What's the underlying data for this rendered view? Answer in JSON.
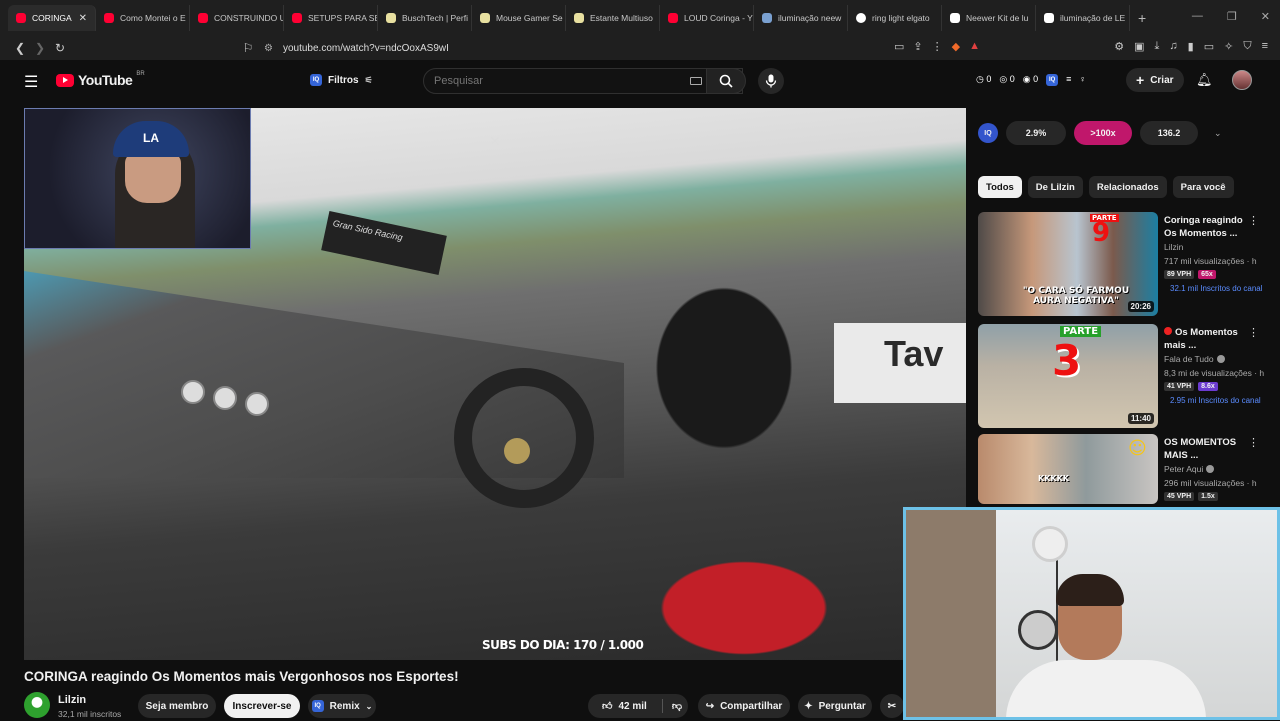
{
  "browser": {
    "tabs": [
      {
        "label": "CORINGA",
        "active": true,
        "favicon_color": "#ff0033"
      },
      {
        "label": "Como Montei o E",
        "favicon_color": "#ff0033"
      },
      {
        "label": "CONSTRUINDO U",
        "favicon_color": "#ff0033"
      },
      {
        "label": "SETUPS PARA SE",
        "favicon_color": "#ff0033"
      },
      {
        "label": "BuschTech | Perfi",
        "favicon_color": "#e8e0a0"
      },
      {
        "label": "Mouse Gamer Se",
        "favicon_color": "#e8e0a0"
      },
      {
        "label": "Estante Multiuso",
        "favicon_color": "#e8e0a0"
      },
      {
        "label": "LOUD Coringa - Y",
        "favicon_color": "#ff0033"
      },
      {
        "label": "iluminação neew",
        "favicon_color": "#7aa0d0"
      },
      {
        "label": "ring light elgato",
        "favicon_color": "#ffffff"
      },
      {
        "label": "Neewer Kit de lu",
        "favicon_color": "#ffffff"
      },
      {
        "label": "iluminação de LE",
        "favicon_color": "#ffffff"
      }
    ],
    "url": "youtube.com/watch?v=ndcOoxAS9wI"
  },
  "header": {
    "logo_text": "YouTube",
    "logo_region": "BR",
    "filters_label": "Filtros",
    "search_placeholder": "Pesquisar",
    "stats": [
      "0",
      "0",
      "0"
    ],
    "create_label": "Criar"
  },
  "player": {
    "subs_overlay": "SUBS DO DIA: 170 / 1.000",
    "banner_left": "Gran Sido Racing",
    "banner_right": "Tav"
  },
  "video": {
    "title": "CORINGA reagindo Os Momentos mais Vergonhosos nos Esportes!",
    "channel": "Lilzin",
    "subscribers": "32,1 mil inscritos",
    "member_label": "Seja membro",
    "subscribe_label": "Inscrever-se",
    "remix_label": "Remix",
    "likes": "42 mil",
    "share_label": "Compartilhar",
    "ask_label": "Perguntar"
  },
  "extension": {
    "stat1": "2.9%",
    "stat2": ">100x",
    "stat3": "136.2"
  },
  "chips": [
    "Todos",
    "De Lilzin",
    "Relacionados",
    "Para você"
  ],
  "recommendations": [
    {
      "title": "Coringa reagindo Os Momentos ...",
      "channel": "Lilzin",
      "views": "717 mil visualizações · h",
      "vph": "89 VPH",
      "mult": "65x",
      "inscritos": "32.1 mil Inscritos do canal",
      "duration": "20:26",
      "thumb_text": "\"O CARA SÓ FARMOU AURA NEGATIVA\"",
      "thumb_num": "9",
      "thumb_tag": "PARTE"
    },
    {
      "title": "Os Momentos mais ...",
      "channel": "Fala de Tudo",
      "views": "8,3 mi de visualizações · h",
      "vph": "41 VPH",
      "mult": "8.6x",
      "inscritos": "2.95 mi Inscritos do canal",
      "duration": "11:40",
      "thumb_num": "3",
      "thumb_tag": "PARTE"
    },
    {
      "title": "OS MOMENTOS MAIS ...",
      "channel": "Peter Aqui",
      "views": "296 mil visualizações · h",
      "vph": "45 VPH",
      "mult": "1.5x",
      "thumb_text": "KKKKK"
    }
  ]
}
